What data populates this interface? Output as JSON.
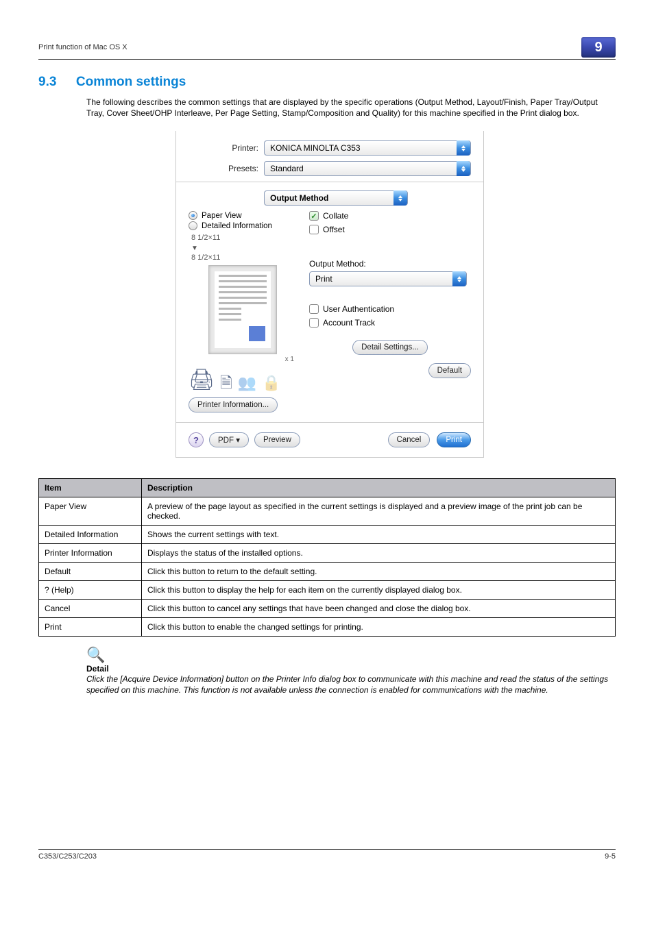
{
  "top": {
    "left_header": "Print function of Mac OS X",
    "chapter": "9"
  },
  "section": {
    "number": "9.3",
    "title": "Common settings"
  },
  "intro": "The following describes the common settings that are displayed by the specific operations (Output Method, Layout/Finish, Paper Tray/Output Tray, Cover Sheet/OHP Interleave, Per Page Setting, Stamp/Composition and Quality) for this machine specified in the Print dialog box.",
  "dialog": {
    "printer_label": "Printer:",
    "printer_value": "KONICA MINOLTA C353",
    "presets_label": "Presets:",
    "presets_value": "Standard",
    "panel_value": "Output Method",
    "paper_view": "Paper View",
    "detailed_info": "Detailed Information",
    "size_top": "8 1/2×11",
    "size_bottom": "8 1/2×11",
    "x1": "x 1",
    "printer_info_btn": "Printer Information...",
    "collate": "Collate",
    "offset": "Offset",
    "output_method_label": "Output Method:",
    "output_method_value": "Print",
    "user_auth": "User Authentication",
    "account_track": "Account Track",
    "detail_settings_btn": "Detail Settings...",
    "default_btn": "Default",
    "pdf_btn": "PDF ▾",
    "preview_btn": "Preview",
    "cancel_btn": "Cancel",
    "print_btn": "Print",
    "help_glyph": "?"
  },
  "table": {
    "h1": "Item",
    "h2": "Description",
    "rows": [
      {
        "item": "Paper View",
        "desc": "A preview of the page layout as specified in the current settings is displayed and a preview image of the print job can be checked."
      },
      {
        "item": "Detailed Information",
        "desc": "Shows the current settings with text."
      },
      {
        "item": "Printer Information",
        "desc": "Displays the status of the installed options."
      },
      {
        "item": "Default",
        "desc": "Click this button to return to the default setting."
      },
      {
        "item": "? (Help)",
        "desc": "Click this button to display the help for each item on the currently displayed dialog box."
      },
      {
        "item": "Cancel",
        "desc": "Click this button to cancel any settings that have been changed and close the dialog box."
      },
      {
        "item": "Print",
        "desc": "Click this button to enable the changed settings for printing."
      }
    ]
  },
  "detail": {
    "head": "Detail",
    "body": "Click the [Acquire Device Information] button on the Printer Info dialog box to communicate with this machine and read the status of the settings specified on this machine. This function is not available unless the connection is enabled for communications with the machine."
  },
  "footer": {
    "left": "C353/C253/C203",
    "right": "9-5"
  }
}
